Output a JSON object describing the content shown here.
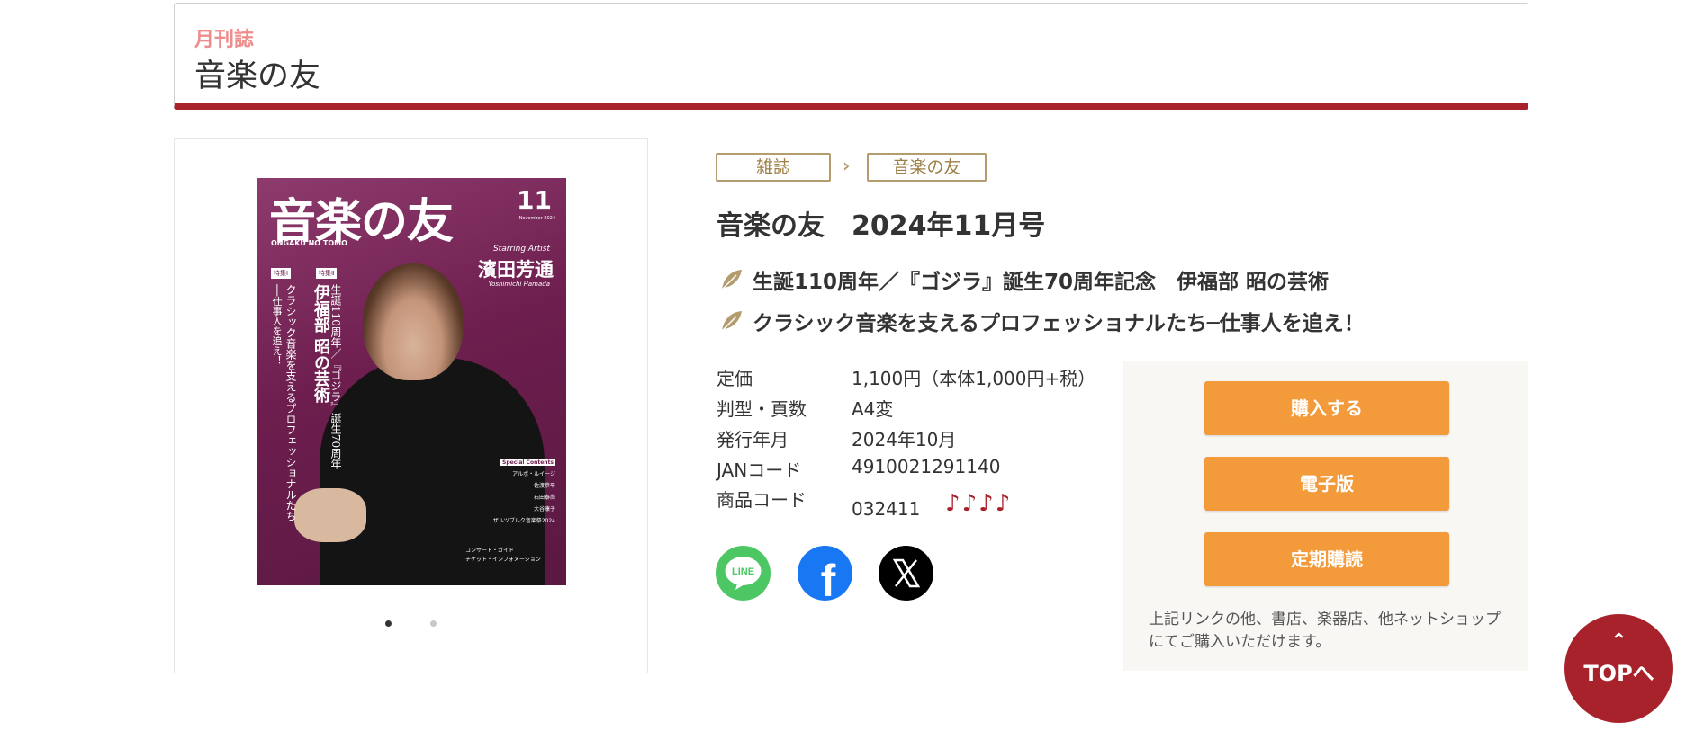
{
  "header": {
    "subtitle": "月刊誌",
    "title": "音楽の友"
  },
  "cover": {
    "title": "音楽の友",
    "roman": "ONGAKU NO TOMO",
    "issue": "11",
    "month": "November 2024",
    "artist_label": "Starring Artist",
    "artist": "濱田芳通",
    "artist_en": "Yoshimichi Hamada",
    "tag1": "特集Ⅰ",
    "tag2": "特集Ⅱ",
    "feature1_line1": "生誕110周年／『ゴジラ』誕生70周年",
    "feature1_line2": "伊福部 昭の芸術",
    "feature2_line1": "クラシック音楽を支えるプロフェッショナルたち",
    "feature2_line2": "──仕事人を追え！",
    "contents_label": "Special Contents",
    "contents": [
      "アルボ・ルイージ",
      "佐渡恭平",
      "石田泰尚",
      "大谷康子",
      "ザルツブルク音楽祭2024"
    ],
    "bottom1": "コンサート・ガイド",
    "bottom2": "チケット・インフォメーション"
  },
  "breadcrumb": {
    "items": [
      "雑誌",
      "音楽の友"
    ],
    "separator": "›"
  },
  "product": {
    "title": "音楽の友　2024年11月号",
    "features": [
      "生誕110周年／『ゴジラ』誕生70周年記念　伊福部 昭の芸術",
      "クラシック音楽を支えるプロフェッショナルたち─仕事人を追え！"
    ],
    "specs": [
      {
        "label": "定価",
        "value": "1,100円（本体1,000円+税）"
      },
      {
        "label": "判型・頁数",
        "value": "A4変"
      },
      {
        "label": "発行年月",
        "value": "2024年10月"
      },
      {
        "label": "JANコード",
        "value": "4910021291140"
      },
      {
        "label": "商品コード",
        "value": "032411"
      }
    ],
    "notes": "♪♪♪♪"
  },
  "sns": {
    "line": "LINE",
    "facebook": "f",
    "x": "X"
  },
  "buy": {
    "purchase": "購入する",
    "ebook": "電子版",
    "subscription": "定期購読",
    "note": "上記リンクの他、書店、楽器店、他ネットショップにてご購入いただけます。"
  },
  "top_button": {
    "chevron": "⌃",
    "label": "TOPへ"
  },
  "colors": {
    "accent_red": "#a8222c",
    "button_orange": "#f39a3a",
    "subtitle_pink": "#ef8c8c",
    "crumb_gold": "#b39c6d",
    "line_green": "#4cc764",
    "facebook_blue": "#1877f2"
  },
  "icons": [
    "leaf-icon",
    "line-icon",
    "facebook-icon",
    "x-icon",
    "chevron-up-icon"
  ]
}
